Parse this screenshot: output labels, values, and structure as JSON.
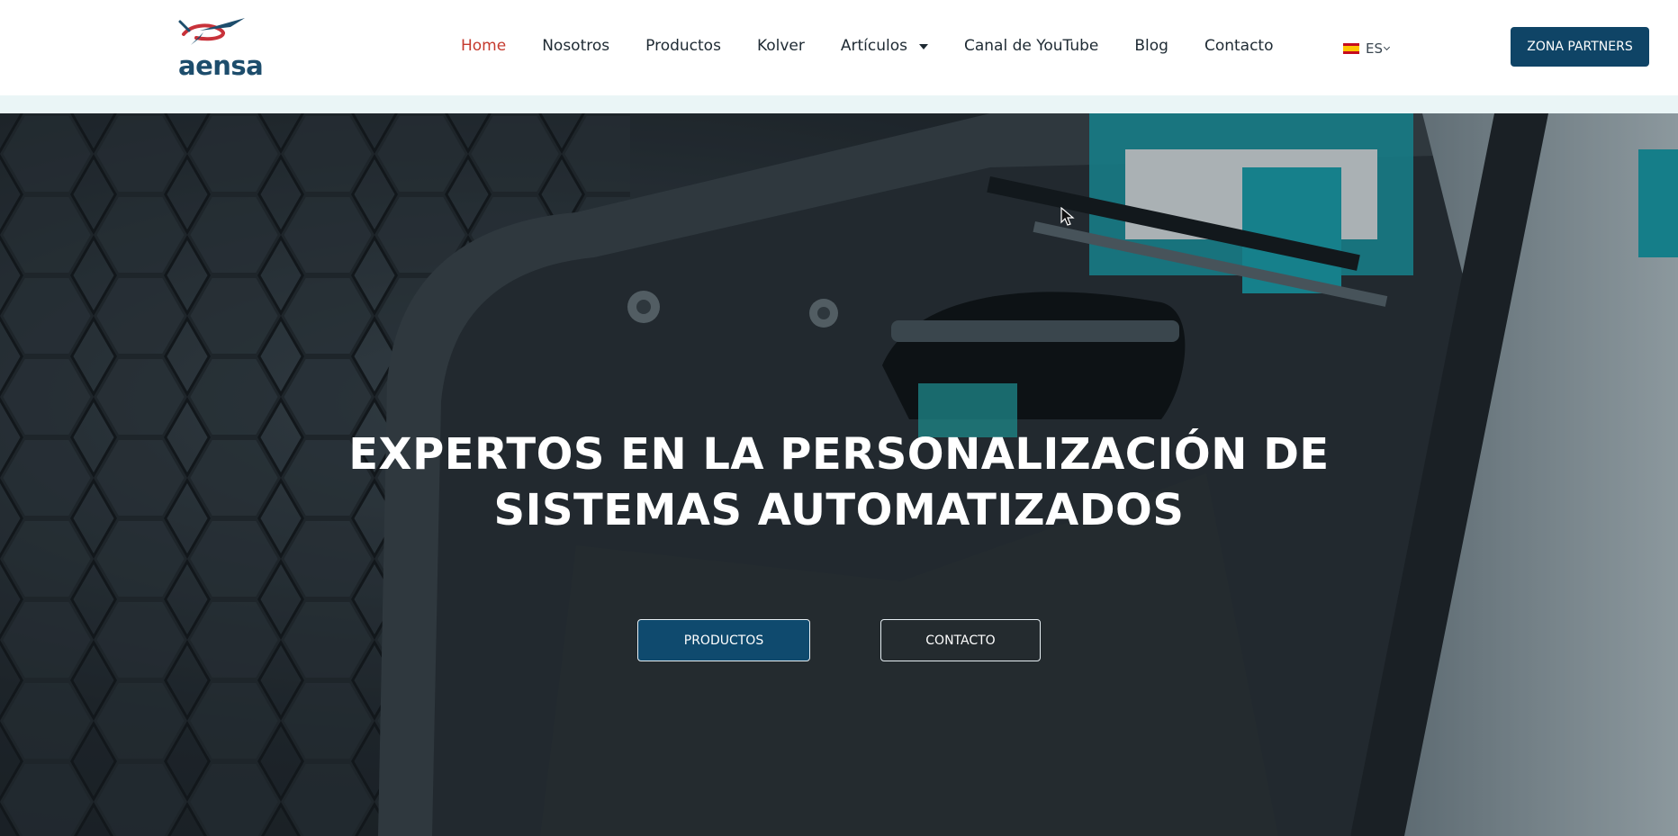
{
  "header": {
    "logo_text": "aensa",
    "nav": [
      {
        "label": "Home",
        "active": true
      },
      {
        "label": "Nosotros"
      },
      {
        "label": "Productos"
      },
      {
        "label": "Kolver"
      },
      {
        "label": "Artículos",
        "has_dropdown": true
      },
      {
        "label": "Canal de YouTube"
      },
      {
        "label": "Blog"
      },
      {
        "label": "Contacto"
      }
    ],
    "language": "ES",
    "partners_button": "ZONA PARTNERS"
  },
  "hero": {
    "title_line1": "EXPERTOS EN LA PERSONALIZACIÓN DE",
    "title_line2": "SISTEMAS AUTOMATIZADOS",
    "buttons": {
      "products": "PRODUCTOS",
      "contact": "CONTACTO"
    }
  },
  "colors": {
    "active_nav": "#c53a2e",
    "brand_blue": "#0f4466",
    "header_strip": "#eaf5f6"
  },
  "icons": {
    "language_flag": "spain-flag-icon",
    "dropdown": "caret-down-icon"
  }
}
